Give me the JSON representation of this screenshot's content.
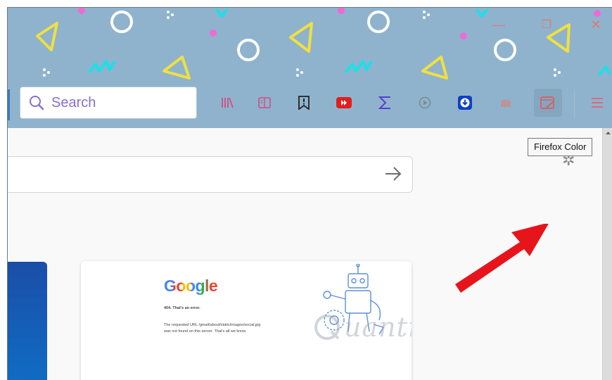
{
  "window": {
    "controls": {
      "minimize": "—",
      "restore": "❐",
      "close": "✕"
    }
  },
  "toolbar": {
    "search_placeholder": "Search",
    "icons": [
      "library-icon",
      "reader-view-icon",
      "bookmark-flag-icon",
      "youtube-icon",
      "sigma-icon",
      "play-circle-icon",
      "download-icon",
      "extension-icon",
      "firefox-color-icon",
      "hamburger-menu-icon"
    ]
  },
  "tooltip": {
    "text": "Firefox Color"
  },
  "content": {
    "tile": {
      "logo": "Google",
      "error_code": "404. That's an error.",
      "error_line1": "The requested URL /gmail/about/static/images/social.jpg",
      "error_line2": "was not found on this server. That's all we know."
    },
    "watermark": "uantrimang"
  },
  "colors": {
    "theme_bg": "#8fb3cd",
    "accent_purple": "#8571cf",
    "arrow_red": "#e8141c",
    "window_controls": "#e0787a"
  }
}
